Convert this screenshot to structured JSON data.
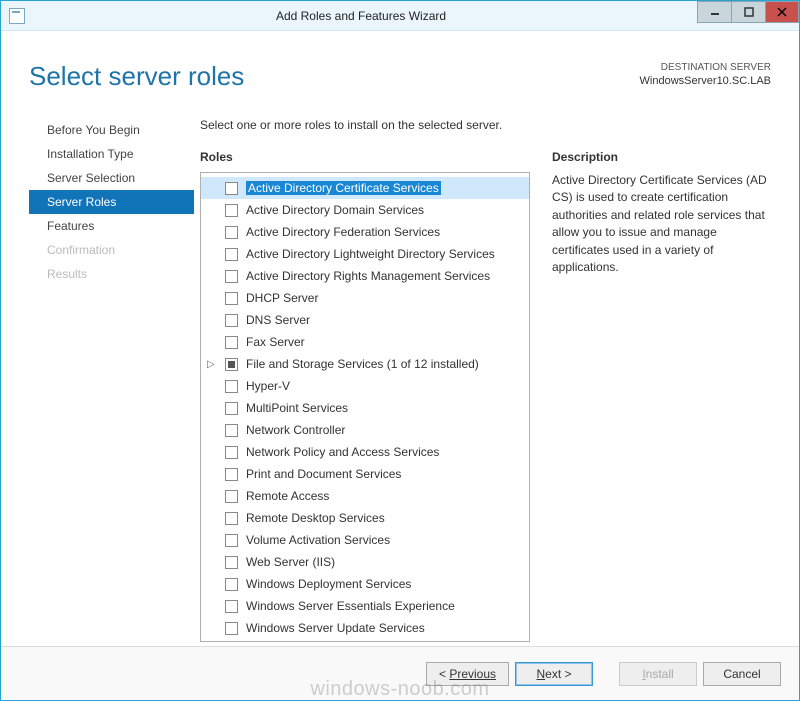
{
  "window": {
    "title": "Add Roles and Features Wizard"
  },
  "header": {
    "page_title": "Select server roles",
    "destination_label": "DESTINATION SERVER",
    "destination_value": "WindowsServer10.SC.LAB"
  },
  "nav": {
    "items": [
      {
        "label": "Before You Begin",
        "state": "normal"
      },
      {
        "label": "Installation Type",
        "state": "normal"
      },
      {
        "label": "Server Selection",
        "state": "normal"
      },
      {
        "label": "Server Roles",
        "state": "active"
      },
      {
        "label": "Features",
        "state": "normal"
      },
      {
        "label": "Confirmation",
        "state": "disabled"
      },
      {
        "label": "Results",
        "state": "disabled"
      }
    ]
  },
  "main": {
    "instruction": "Select one or more roles to install on the selected server.",
    "roles_label": "Roles",
    "description_label": "Description",
    "description_text": "Active Directory Certificate Services (AD CS) is used to create certification authorities and related role services that allow you to issue and manage certificates used in a variety of applications."
  },
  "roles": [
    {
      "label": "Active Directory Certificate Services",
      "checked": false,
      "selected": true
    },
    {
      "label": "Active Directory Domain Services",
      "checked": false
    },
    {
      "label": "Active Directory Federation Services",
      "checked": false
    },
    {
      "label": "Active Directory Lightweight Directory Services",
      "checked": false
    },
    {
      "label": "Active Directory Rights Management Services",
      "checked": false
    },
    {
      "label": "DHCP Server",
      "checked": false
    },
    {
      "label": "DNS Server",
      "checked": false
    },
    {
      "label": "Fax Server",
      "checked": false
    },
    {
      "label": "File and Storage Services (1 of 12 installed)",
      "checked": "partial",
      "expandable": true
    },
    {
      "label": "Hyper-V",
      "checked": false
    },
    {
      "label": "MultiPoint Services",
      "checked": false
    },
    {
      "label": "Network Controller",
      "checked": false
    },
    {
      "label": "Network Policy and Access Services",
      "checked": false
    },
    {
      "label": "Print and Document Services",
      "checked": false
    },
    {
      "label": "Remote Access",
      "checked": false
    },
    {
      "label": "Remote Desktop Services",
      "checked": false
    },
    {
      "label": "Volume Activation Services",
      "checked": false
    },
    {
      "label": "Web Server (IIS)",
      "checked": false
    },
    {
      "label": "Windows Deployment Services",
      "checked": false
    },
    {
      "label": "Windows Server Essentials Experience",
      "checked": false
    },
    {
      "label": "Windows Server Update Services",
      "checked": false
    }
  ],
  "buttons": {
    "previous": "Previous",
    "next": "Next >",
    "install": "Install",
    "cancel": "Cancel"
  },
  "watermark": "windows-noob.com"
}
